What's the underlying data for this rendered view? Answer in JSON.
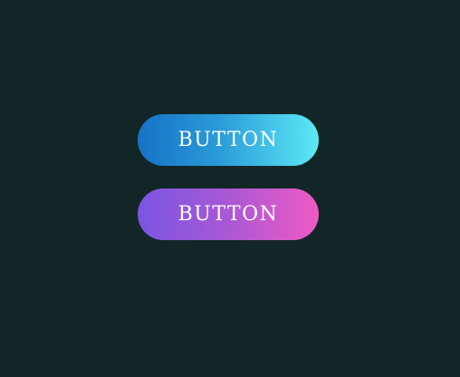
{
  "buttons": [
    {
      "label": "BUTTON",
      "gradient_start": "#1672c7",
      "gradient_end": "#5ce9f6"
    },
    {
      "label": "BUTTON",
      "gradient_start": "#7b55e3",
      "gradient_end": "#ee5ac4"
    }
  ],
  "colors": {
    "background": "#132627",
    "text": "#ffffff"
  }
}
